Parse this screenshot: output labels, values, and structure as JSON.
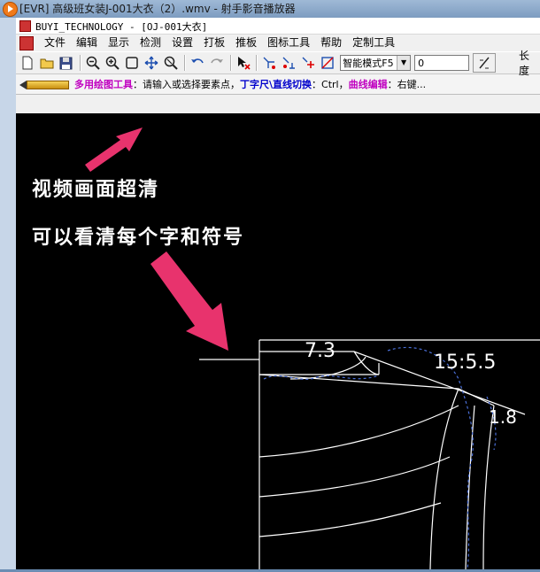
{
  "window": {
    "outer_title": "[EVR] 高级班女装J-001大衣（2）.wmv - 射手影音播放器",
    "inner_title": "BUYI_TECHNOLOGY - [OJ-001大衣]"
  },
  "menu": [
    "文件",
    "编辑",
    "显示",
    "检测",
    "设置",
    "打板",
    "推板",
    "图标工具",
    "帮助",
    "定制工具"
  ],
  "toolbar": {
    "mode_select": "智能模式F5",
    "value_input": "0",
    "length_label": "长度"
  },
  "hint": {
    "tool_name": "多用绘图工具",
    "text1": "：请输入或选择要素点，",
    "toggle": "丁字尺\\直线切换",
    "text2": "：Ctrl，",
    "curve": "曲线编辑",
    "text3": "：右键..."
  },
  "overlay": {
    "line1": "视频画面超清",
    "line2": "可以看清每个字和符号"
  },
  "drawing": {
    "dim_a": "7.3",
    "dim_b": "15:5.5",
    "dim_c": "1.8"
  },
  "colors": {
    "canvas": "#000000",
    "arrow": "#e8336d",
    "pattern_line": "#ffffff",
    "dashed_curve": "#4a6fd8"
  }
}
